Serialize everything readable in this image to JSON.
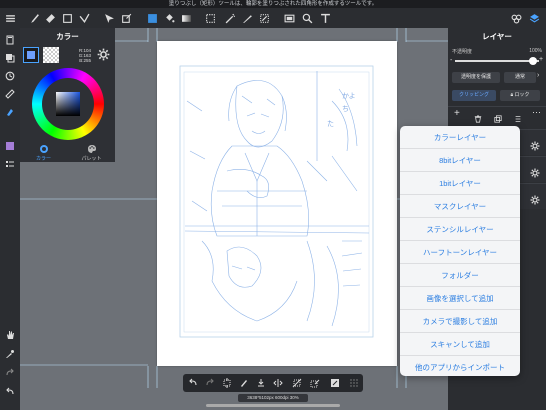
{
  "status_message": "塗りつぶし（矩形）ツールは、輪郭を塗りつぶされた四角形を作成するツールです。",
  "toolbar": {
    "icons": [
      "menu-icon",
      "brush-icon",
      "eraser-icon",
      "square-icon",
      "transform-icon",
      "select-arrow-icon",
      "fill-color-icon",
      "bucket-icon",
      "gradient-icon",
      "rect-select-icon",
      "magic-wand-icon",
      "select-pen-icon",
      "select-eraser-icon",
      "canvas-icon",
      "zoom-icon",
      "text-icon",
      "materials-icon",
      "layers-icon"
    ]
  },
  "color_panel": {
    "title": "カラー",
    "r": "R:104",
    "g": "G:163",
    "b": "B:255",
    "primary_color": "#6d9ffd",
    "tabs": [
      {
        "label": "カラー",
        "active": true
      },
      {
        "label": "パレット",
        "active": false
      }
    ]
  },
  "layer_panel": {
    "title": "レイヤー",
    "opacity_label": "不透明度",
    "opacity_value": "100%",
    "opacity": 1.0,
    "protect_label": "透明度を保護",
    "blend_label": "通常",
    "clipping_label": "クリッピング",
    "lock_label": "ロック"
  },
  "add_layer_menu": {
    "items": [
      "カラーレイヤー",
      "8bitレイヤー",
      "1bitレイヤー",
      "マスクレイヤー",
      "ステンシルレイヤー",
      "ハーフトーンレイヤー",
      "フォルダー",
      "画像を選択して追加",
      "カメラで撮影して追加",
      "スキャンして追加",
      "他のアプリからインポート"
    ]
  },
  "canvas_info": "3638*5102px 600dpi 30%",
  "accent_color": "#2a7de1"
}
